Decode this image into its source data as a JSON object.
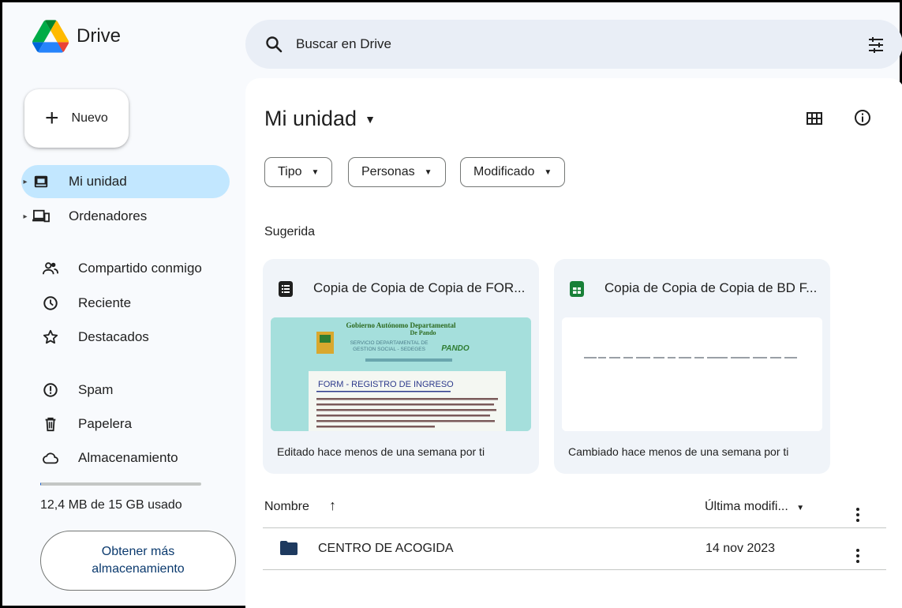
{
  "app": {
    "name": "Drive"
  },
  "search": {
    "placeholder": "Buscar en Drive"
  },
  "new_button": {
    "label": "Nuevo"
  },
  "sidebar": {
    "items": [
      {
        "label": "Mi unidad",
        "icon": "drive-icon",
        "active": true
      },
      {
        "label": "Ordenadores",
        "icon": "computer-icon"
      },
      {
        "label": "Compartido conmigo",
        "icon": "shared-people-icon"
      },
      {
        "label": "Reciente",
        "icon": "clock-icon"
      },
      {
        "label": "Destacados",
        "icon": "star-icon"
      },
      {
        "label": "Spam",
        "icon": "spam-icon"
      },
      {
        "label": "Papelera",
        "icon": "trash-icon"
      },
      {
        "label": "Almacenamiento",
        "icon": "cloud-icon"
      }
    ],
    "storage": {
      "used_text": "12,4 MB de 15 GB usado",
      "used_fraction": 0.0008,
      "cta": "Obtener más almacenamiento"
    }
  },
  "main": {
    "title": "Mi unidad",
    "filters": [
      "Tipo",
      "Personas",
      "Modificado"
    ],
    "suggested_label": "Sugerida",
    "cards": [
      {
        "title": "Copia de Copia de Copia de FOR...",
        "footer": "Editado hace menos de una semana por ti",
        "type": "forms",
        "color": "#1f1f1f",
        "preview": {
          "org_line1": "Gobierno Autónomo Departamental",
          "org_line2": "De Pando",
          "service_line1": "SERVICIO DEPARTAMENTAL DE",
          "service_line2": "GESTION SOCIAL - SEDEGES",
          "brand": "PANDO",
          "form_title": "FORM - REGISTRO DE INGRESO"
        }
      },
      {
        "title": "Copia de Copia de Copia de BD F...",
        "footer": "Cambiado hace menos de una semana por ti",
        "type": "sheets",
        "color": "#188038"
      }
    ],
    "list": {
      "headers": {
        "name": "Nombre",
        "modified": "Última modifi..."
      },
      "rows": [
        {
          "name": "CENTRO DE ACOGIDA",
          "modified": "14 nov 2023",
          "type": "folder"
        }
      ]
    }
  },
  "colors": {
    "active_nav": "#c2e7ff",
    "search_bg": "#e9eef6",
    "accent": "#0b57d0",
    "card_bg": "#f0f4f9"
  }
}
